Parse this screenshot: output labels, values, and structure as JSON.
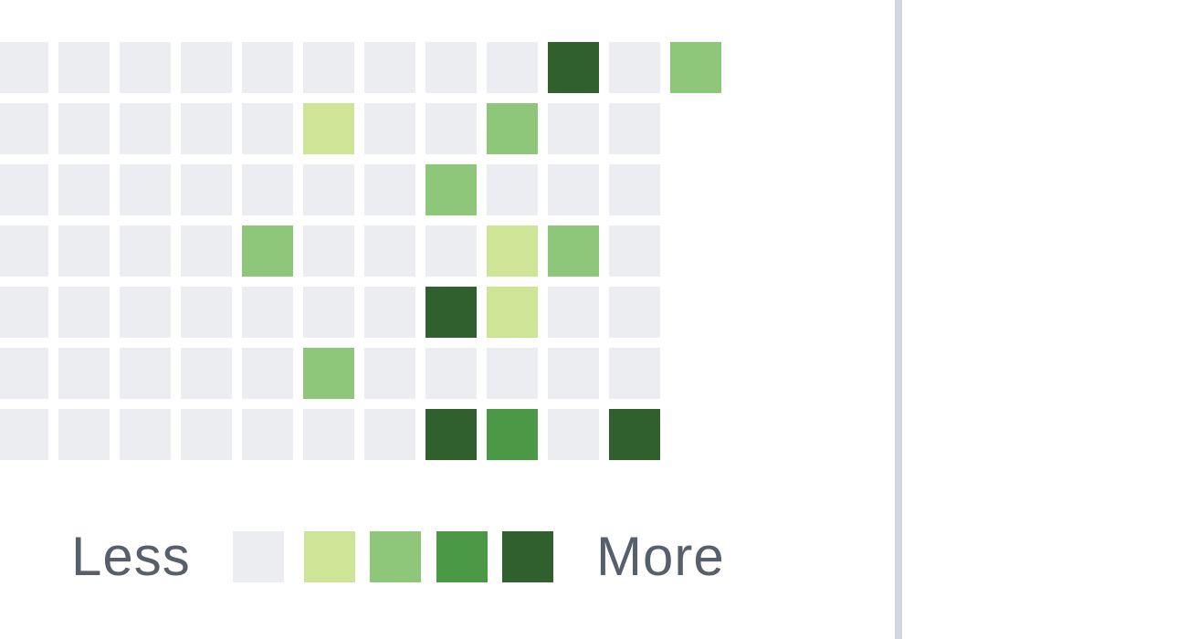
{
  "colors": {
    "level0": "#ebedf0",
    "level1": "#cee597",
    "level2": "#8fc77a",
    "level3": "#4b9846",
    "level4": "#2f602d",
    "divider": "#d0d7de",
    "text": "#57606a"
  },
  "contribution_grid": {
    "columns": [
      [
        0,
        0,
        0,
        0,
        0,
        0,
        0
      ],
      [
        0,
        0,
        0,
        0,
        0,
        0,
        0
      ],
      [
        0,
        0,
        0,
        0,
        0,
        0,
        0
      ],
      [
        0,
        0,
        0,
        0,
        0,
        0,
        0
      ],
      [
        0,
        0,
        0,
        2,
        0,
        0,
        0
      ],
      [
        0,
        1,
        0,
        0,
        0,
        2,
        0
      ],
      [
        0,
        0,
        0,
        0,
        0,
        0,
        0
      ],
      [
        0,
        0,
        2,
        0,
        4,
        0,
        4
      ],
      [
        0,
        2,
        0,
        1,
        1,
        0,
        3
      ],
      [
        4,
        0,
        0,
        2,
        0,
        0,
        0
      ],
      [
        0,
        0,
        0,
        0,
        0,
        0,
        4
      ],
      [
        2
      ]
    ]
  },
  "legend": {
    "less_label": "Less",
    "more_label": "More",
    "levels": [
      0,
      1,
      2,
      3,
      4
    ]
  }
}
